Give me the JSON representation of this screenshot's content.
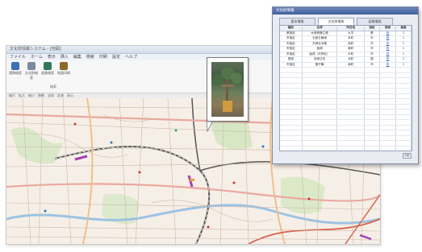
{
  "main_window": {
    "title": "文化財情報システム - [地図]",
    "ribbon_tabs": [
      "ファイル",
      "ホーム",
      "表示",
      "挿入",
      "編集",
      "検索",
      "印刷",
      "設定",
      "ヘルプ"
    ],
    "ribbon_buttons": [
      {
        "label": "遺跡検索",
        "icon": "search-icon",
        "color": "#3d6fb6"
      },
      {
        "label": "文化財検索",
        "icon": "document-icon",
        "color": "#7a8aa0"
      },
      {
        "label": "画像検索",
        "icon": "image-icon",
        "color": "#2f7a5a"
      },
      {
        "label": "地図印刷",
        "icon": "printer-icon",
        "color": "#8a6a2f"
      }
    ],
    "ribbon_group_label": "検索",
    "map_toolbar": [
      "縮尺",
      "拡大",
      "縮小",
      "移動",
      "全体",
      "計測",
      "表示"
    ]
  },
  "callout": {
    "photo_icon": "photo-icon"
  },
  "dialog": {
    "title": "文化財情報",
    "tabs": [
      "基本情報",
      "文化財情報",
      "画像情報"
    ],
    "active_tab": 1,
    "columns": [
      "種別",
      "名称",
      "所在地",
      "指定",
      "登録",
      "画像"
    ],
    "rows": [
      [
        "県指定",
        "木造菩薩立像",
        "大字",
        "県",
        "有",
        "1"
      ],
      [
        "市指定",
        "石造五輪塔",
        "本町",
        "市",
        "有",
        "1"
      ],
      [
        "市指定",
        "天神社本殿",
        "西町",
        "市",
        "有",
        "1"
      ],
      [
        "市指定",
        "板碑",
        "東町",
        "市",
        "有",
        "1"
      ],
      [
        "市指定",
        "絵馬（天神社）",
        "中町",
        "市",
        "有",
        "1"
      ],
      [
        "登録",
        "旧家住宅",
        "北町",
        "国",
        "有",
        "1"
      ],
      [
        "市指定",
        "獅子舞",
        "南町",
        "市",
        "有",
        "1"
      ]
    ],
    "empty_rows": 19,
    "ok_label": "OK"
  }
}
